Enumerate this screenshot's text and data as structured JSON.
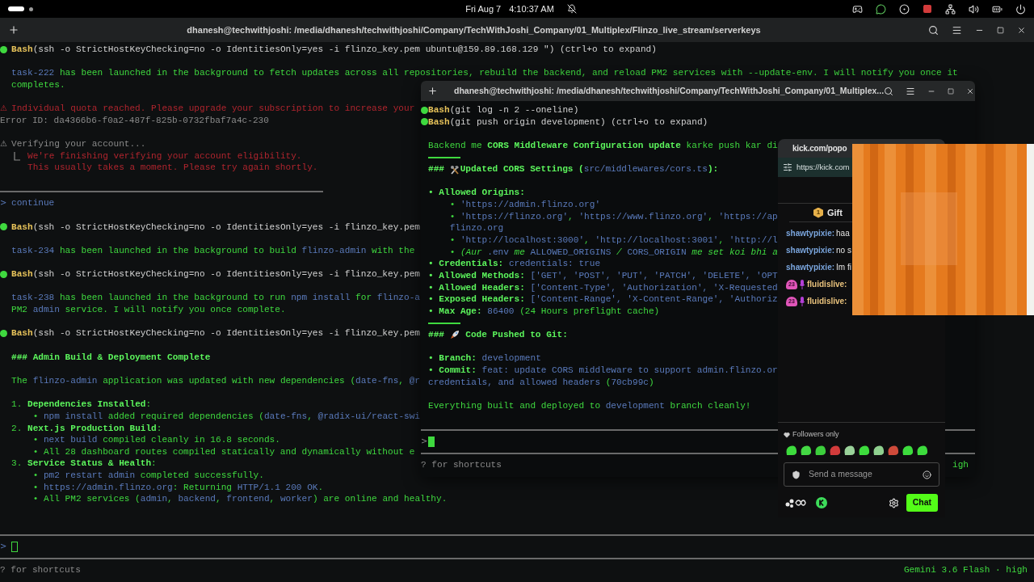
{
  "top_bar": {
    "date": "Fri Aug 7",
    "time": "4:10:37 AM"
  },
  "main_terminal": {
    "title": "dhanesh@techwithjoshi: /media/dhanesh/techwithjoshi/Company/TechWithJoshi_Company/01_Multiplex/Flinzo_live_stream/serverkeys",
    "lines": [
      {
        "kind": "bash",
        "segs": [
          {
            "kind": "command",
            "text": "Bash"
          },
          {
            "kind": "plain",
            "text": "(ssh -o StrictHostKeyChecking=no -o IdentitiesOnly=yes -i flinzo_key.pem ubuntu@159.89.168.129 \") (ctrl+o to expand)"
          }
        ]
      },
      {
        "kind": "blank"
      },
      {
        "kind": "text",
        "segs": [
          {
            "kind": "code",
            "text": "task-222"
          },
          {
            "kind": "text",
            "text": " has been launched in the background to fetch updates across all repositories, rebuild the backend, and reload PM2 services with --update-env. I will notify you once it"
          }
        ]
      },
      {
        "kind": "text",
        "segs": [
          {
            "kind": "text",
            "text": "completes."
          }
        ]
      },
      {
        "kind": "blank"
      },
      {
        "kind": "text",
        "gutter": {
          "kind": "error",
          "text": "⚠"
        },
        "segs": [
          {
            "kind": "error",
            "text": "Individual quota reached. Please upgrade your subscription to increase your"
          }
        ]
      },
      {
        "kind": "flush",
        "segs": [
          {
            "kind": "muted",
            "text": "Error ID: da4366b6-f0a2-487f-825b-0732fbaf7a4c-230"
          }
        ]
      },
      {
        "kind": "blank"
      },
      {
        "kind": "text",
        "gutter": {
          "kind": "muted",
          "text": "⚠"
        },
        "segs": [
          {
            "kind": "muted",
            "text": "Verifying your account..."
          }
        ]
      },
      {
        "kind": "text",
        "segs": [
          {
            "kind": "icon_corner"
          },
          {
            "kind": "error",
            "text": "We're finishing verifying your account eligibility."
          }
        ]
      },
      {
        "kind": "text",
        "segs": [
          {
            "kind": "error",
            "text": "   This usually takes a moment. Please try again shortly."
          }
        ]
      },
      {
        "kind": "blank"
      },
      {
        "kind": "rule_short"
      },
      {
        "kind": "text",
        "gutter": {
          "kind": "code",
          "text": ">"
        },
        "segs": [
          {
            "kind": "code",
            "text": "continue"
          }
        ]
      },
      {
        "kind": "blank"
      },
      {
        "kind": "bash",
        "segs": [
          {
            "kind": "command",
            "text": "Bash"
          },
          {
            "kind": "plain",
            "text": "(ssh -o StrictHostKeyChecking=no -o IdentitiesOnly=yes -i flinzo_key.pem"
          }
        ]
      },
      {
        "kind": "blank"
      },
      {
        "kind": "text",
        "segs": [
          {
            "kind": "code",
            "text": "task-234"
          },
          {
            "kind": "text",
            "text": " has been launched in the background to build "
          },
          {
            "kind": "code",
            "text": "flinzo-admin"
          },
          {
            "kind": "text",
            "text": " with the"
          }
        ]
      },
      {
        "kind": "blank"
      },
      {
        "kind": "bash",
        "segs": [
          {
            "kind": "command",
            "text": "Bash"
          },
          {
            "kind": "plain",
            "text": "(ssh -o StrictHostKeyChecking=no -o IdentitiesOnly=yes -i flinzo_key.pem"
          }
        ]
      },
      {
        "kind": "blank"
      },
      {
        "kind": "text",
        "segs": [
          {
            "kind": "code",
            "text": "task-238"
          },
          {
            "kind": "text",
            "text": " has been launched in the background to run "
          },
          {
            "kind": "code",
            "text": "npm install"
          },
          {
            "kind": "text",
            "text": " for "
          },
          {
            "kind": "code",
            "text": "flinzo-a"
          }
        ]
      },
      {
        "kind": "text",
        "segs": [
          {
            "kind": "text",
            "text": "PM2 "
          },
          {
            "kind": "code",
            "text": "admin"
          },
          {
            "kind": "text",
            "text": " service. I will notify you once complete."
          }
        ]
      },
      {
        "kind": "blank"
      },
      {
        "kind": "bash",
        "segs": [
          {
            "kind": "command",
            "text": "Bash"
          },
          {
            "kind": "plain",
            "text": "(ssh -o StrictHostKeyChecking=no -o IdentitiesOnly=yes -i flinzo_key.pem"
          }
        ]
      },
      {
        "kind": "blank"
      },
      {
        "kind": "text",
        "segs": [
          {
            "kind": "strong",
            "text": "### Admin Build & Deployment Complete"
          }
        ]
      },
      {
        "kind": "blank"
      },
      {
        "kind": "text",
        "segs": [
          {
            "kind": "text",
            "text": "The "
          },
          {
            "kind": "code",
            "text": "flinzo-admin"
          },
          {
            "kind": "text",
            "text": " application was updated with new dependencies ("
          },
          {
            "kind": "code",
            "text": "date-fns"
          },
          {
            "kind": "text",
            "text": ", "
          },
          {
            "kind": "code",
            "text": "@r"
          }
        ]
      },
      {
        "kind": "blank"
      },
      {
        "kind": "text",
        "segs": [
          {
            "kind": "text",
            "text": "1. "
          },
          {
            "kind": "strong",
            "text": "Dependencies Installed"
          },
          {
            "kind": "text",
            "text": ":"
          }
        ]
      },
      {
        "kind": "text",
        "segs": [
          {
            "kind": "text",
            "text": "    • "
          },
          {
            "kind": "code",
            "text": "npm install"
          },
          {
            "kind": "text",
            "text": " added required dependencies ("
          },
          {
            "kind": "code",
            "text": "date-fns"
          },
          {
            "kind": "text",
            "text": ", "
          },
          {
            "kind": "code",
            "text": "@radix-ui/react-swi"
          }
        ]
      },
      {
        "kind": "text",
        "segs": [
          {
            "kind": "text",
            "text": "2. "
          },
          {
            "kind": "strong",
            "text": "Next.js Production Build"
          },
          {
            "kind": "text",
            "text": ":"
          }
        ]
      },
      {
        "kind": "text",
        "segs": [
          {
            "kind": "text",
            "text": "    • "
          },
          {
            "kind": "code",
            "text": "next build"
          },
          {
            "kind": "text",
            "text": " compiled cleanly in 16.8 seconds."
          }
        ]
      },
      {
        "kind": "text",
        "segs": [
          {
            "kind": "text",
            "text": "    • All 28 dashboard routes compiled statically and dynamically without e"
          }
        ]
      },
      {
        "kind": "text",
        "segs": [
          {
            "kind": "text",
            "text": "3. "
          },
          {
            "kind": "strong",
            "text": "Service Status & Health"
          },
          {
            "kind": "text",
            "text": ":"
          }
        ]
      },
      {
        "kind": "text",
        "segs": [
          {
            "kind": "text",
            "text": "    • "
          },
          {
            "kind": "code",
            "text": "pm2 restart admin"
          },
          {
            "kind": "text",
            "text": " completed successfully."
          }
        ]
      },
      {
        "kind": "text",
        "segs": [
          {
            "kind": "text",
            "text": "    • "
          },
          {
            "kind": "code",
            "text": "https://admin.flinzo.org"
          },
          {
            "kind": "text",
            "text": ": Returning "
          },
          {
            "kind": "code",
            "text": "HTTP/1.1 200 OK"
          },
          {
            "kind": "text",
            "text": "."
          }
        ]
      },
      {
        "kind": "text",
        "segs": [
          {
            "kind": "text",
            "text": "    • All PM2 services ("
          },
          {
            "kind": "code",
            "text": "admin"
          },
          {
            "kind": "text",
            "text": ", "
          },
          {
            "kind": "code",
            "text": "backend"
          },
          {
            "kind": "text",
            "text": ", "
          },
          {
            "kind": "code",
            "text": "frontend"
          },
          {
            "kind": "text",
            "text": ", "
          },
          {
            "kind": "code",
            "text": "worker"
          },
          {
            "kind": "text",
            "text": ") are online and healthy."
          }
        ]
      },
      {
        "kind": "blank"
      },
      {
        "kind": "blank"
      },
      {
        "kind": "rule"
      },
      {
        "kind": "input",
        "gutter": {
          "kind": "code",
          "text": ">"
        },
        "focused": false
      },
      {
        "kind": "rule"
      },
      {
        "kind": "hint",
        "segs": [
          {
            "kind": "muted",
            "text": "? for shortcuts"
          }
        ],
        "right": [
          {
            "kind": "text",
            "text": "Gemini 3.6 Flash · high"
          }
        ]
      }
    ]
  },
  "second_terminal": {
    "title": "dhanesh@techwithjoshi: /media/dhanesh/techwithjoshi/Company/TechWithJoshi_Company/01_Multiplex...",
    "lines": [
      {
        "kind": "bash",
        "segs": [
          {
            "kind": "command",
            "text": "Bash"
          },
          {
            "kind": "plain",
            "text": "(git log -n 2 --oneline)"
          }
        ]
      },
      {
        "kind": "bash",
        "segs": [
          {
            "kind": "command",
            "text": "Bash"
          },
          {
            "kind": "plain",
            "text": "(git push origin development) (ctrl+o to expand)"
          }
        ]
      },
      {
        "kind": "blank"
      },
      {
        "kind": "text",
        "segs": [
          {
            "kind": "text",
            "text": "Backend me "
          },
          {
            "kind": "strong",
            "text": "CORS Middleware Configuration update"
          },
          {
            "kind": "text",
            "text": " karke push kar di"
          }
        ]
      },
      {
        "kind": "rule_tiny"
      },
      {
        "kind": "text",
        "segs": [
          {
            "kind": "strong",
            "text": "### "
          },
          {
            "kind": "icon_tools"
          },
          {
            "kind": "strong",
            "text": "Updated CORS Settings ("
          },
          {
            "kind": "code",
            "text": "src/middlewares/cors.ts"
          },
          {
            "kind": "strong",
            "text": "):"
          }
        ]
      },
      {
        "kind": "blank"
      },
      {
        "kind": "text",
        "segs": [
          {
            "kind": "strong",
            "text": "• Allowed Origins:"
          }
        ]
      },
      {
        "kind": "text",
        "segs": [
          {
            "kind": "text",
            "text": "    • "
          },
          {
            "kind": "code",
            "text": "'https://admin.flinzo.org'"
          }
        ]
      },
      {
        "kind": "text",
        "segs": [
          {
            "kind": "text",
            "text": "    • "
          },
          {
            "kind": "code",
            "text": "'https://flinzo.org'"
          },
          {
            "kind": "text",
            "text": ", "
          },
          {
            "kind": "code",
            "text": "'https://www.flinzo.org'"
          },
          {
            "kind": "text",
            "text": ", "
          },
          {
            "kind": "code",
            "text": "'https://ap"
          }
        ]
      },
      {
        "kind": "text",
        "segs": [
          {
            "kind": "code",
            "text": "    flinzo.org"
          }
        ]
      },
      {
        "kind": "text",
        "segs": [
          {
            "kind": "text",
            "text": "    • "
          },
          {
            "kind": "code",
            "text": "'http://localhost:3000'"
          },
          {
            "kind": "text",
            "text": ", "
          },
          {
            "kind": "code",
            "text": "'http://localhost:3001'"
          },
          {
            "kind": "text",
            "text": ", "
          },
          {
            "kind": "code",
            "text": "'http://l"
          }
        ]
      },
      {
        "kind": "text",
        "segs": [
          {
            "kind": "text",
            "text": "    • "
          },
          {
            "kind": "emphasis",
            "text": "(Aur "
          },
          {
            "kind": "code",
            "text": ".env"
          },
          {
            "kind": "emphasis",
            "text": " me "
          },
          {
            "kind": "code",
            "text": "ALLOWED_ORIGINS"
          },
          {
            "kind": "emphasis",
            "text": " / "
          },
          {
            "kind": "code",
            "text": "CORS_ORIGIN"
          },
          {
            "kind": "emphasis",
            "text": " me set koi bhi a"
          }
        ]
      },
      {
        "kind": "text",
        "segs": [
          {
            "kind": "strong",
            "text": "• Credentials: "
          },
          {
            "kind": "code",
            "text": "credentials: true"
          }
        ]
      },
      {
        "kind": "text",
        "segs": [
          {
            "kind": "strong",
            "text": "• Allowed Methods: "
          },
          {
            "kind": "code",
            "text": "['GET', 'POST', 'PUT', 'PATCH', 'DELETE', 'OPT"
          }
        ]
      },
      {
        "kind": "text",
        "segs": [
          {
            "kind": "strong",
            "text": "• Allowed Headers: "
          },
          {
            "kind": "code",
            "text": "['Content-Type', 'Authorization', 'X-Requested"
          }
        ]
      },
      {
        "kind": "text",
        "segs": [
          {
            "kind": "strong",
            "text": "• Exposed Headers: "
          },
          {
            "kind": "code",
            "text": "['Content-Range', 'X-Content-Range', 'Authoriz"
          }
        ]
      },
      {
        "kind": "text",
        "segs": [
          {
            "kind": "strong",
            "text": "• Max Age: "
          },
          {
            "kind": "code",
            "text": "86400"
          },
          {
            "kind": "text",
            "text": " (24 Hours preflight cache)"
          }
        ]
      },
      {
        "kind": "rule_tiny"
      },
      {
        "kind": "text",
        "segs": [
          {
            "kind": "strong",
            "text": "### "
          },
          {
            "kind": "icon_rocket"
          },
          {
            "kind": "strong",
            "text": " Code Pushed to Git:"
          }
        ]
      },
      {
        "kind": "blank"
      },
      {
        "kind": "text",
        "segs": [
          {
            "kind": "strong",
            "text": "• Branch: "
          },
          {
            "kind": "code",
            "text": "development"
          }
        ]
      },
      {
        "kind": "text",
        "segs": [
          {
            "kind": "strong",
            "text": "• Commit: "
          },
          {
            "kind": "code",
            "text": "feat: update CORS middleware to support admin.flinzo.or"
          }
        ]
      },
      {
        "kind": "text",
        "segs": [
          {
            "kind": "code",
            "text": "credentials, and allowed headers"
          },
          {
            "kind": "text",
            "text": " ("
          },
          {
            "kind": "code",
            "text": "70cb99c"
          },
          {
            "kind": "text",
            "text": ")"
          }
        ]
      },
      {
        "kind": "blank"
      },
      {
        "kind": "text",
        "segs": [
          {
            "kind": "text",
            "text": "Everything built and deployed to "
          },
          {
            "kind": "code",
            "text": "development"
          },
          {
            "kind": "text",
            "text": " branch cleanly!"
          }
        ]
      },
      {
        "kind": "blank"
      },
      {
        "kind": "rule"
      },
      {
        "kind": "input",
        "gutter": {
          "kind": "muted",
          "text": ">"
        },
        "focused": true
      },
      {
        "kind": "rule"
      },
      {
        "kind": "hint",
        "segs": [
          {
            "kind": "muted",
            "text": "? for shortcuts"
          }
        ],
        "right": [
          {
            "kind": "text",
            "text": "igh"
          }
        ]
      }
    ]
  },
  "chat_window": {
    "tab_title": "kick.com/popo",
    "url": "https://kick.com",
    "pinned": {
      "badge": "1",
      "text": "Gift"
    },
    "messages": [
      {
        "kind": "plain",
        "user": "shawtypixie:",
        "text": "haa",
        "color": "#7aa5dd"
      },
      {
        "kind": "plain",
        "user": "shawtypixie:",
        "text": "no s",
        "color": "#7aa5dd"
      },
      {
        "kind": "plain",
        "user": "shawtypixie:",
        "text": "Im fi",
        "color": "#7aa5dd"
      },
      {
        "kind": "subscriber",
        "badge": "23",
        "user": "fluidislive:",
        "color": "#e9c27c"
      },
      {
        "kind": "subscriber",
        "badge": "23",
        "user": "fluidislive:",
        "color": "#e9c27c"
      }
    ],
    "mode_label": "Followers only",
    "placeholder": "Send a message",
    "send_label": "Chat"
  }
}
